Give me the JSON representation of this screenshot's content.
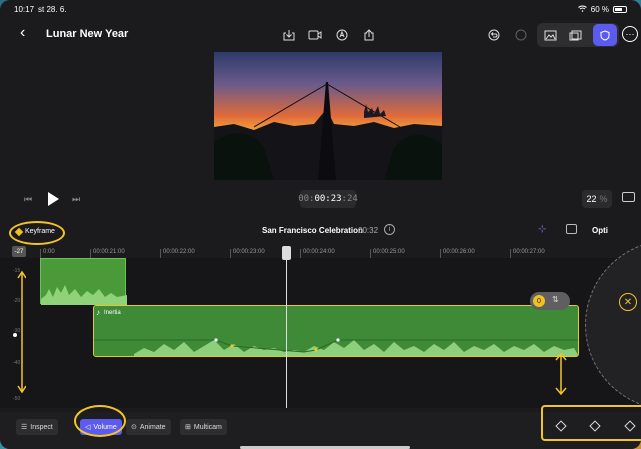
{
  "status_bar": {
    "time": "10:17",
    "date": "st 28. 6.",
    "battery": "60 %"
  },
  "nav": {
    "back_icon": "‹",
    "title": "Lunar New Year"
  },
  "transport": {
    "timecode_dim": "00:",
    "timecode": "00:23",
    "timecode_frames": ":24",
    "zoom_value": "22",
    "zoom_unit": "%"
  },
  "timeline_header": {
    "keyframe_label": "Keyframe",
    "clip_title": "San Francisco Celebration",
    "clip_duration": "00:32",
    "options_label": "Opti"
  },
  "ruler": {
    "db_top": "-27",
    "ticks": [
      "0:00",
      "00:00:21:00",
      "00:00:22:00",
      "00:00:23:00",
      "00:00:24:00",
      "00:00:25:00",
      "00:00:26:00",
      "00:00:27:00"
    ]
  },
  "meter_labels": [
    "-15",
    "-20",
    "-30",
    "-40",
    "-50"
  ],
  "audio_clip": {
    "name": "Inertia",
    "note_icon": "♪"
  },
  "volume_pill": {
    "value": "0"
  },
  "bottom_bar": {
    "inspect": "Inspect",
    "volume": "Volume",
    "animate": "Animate",
    "multicam": "Multicam"
  },
  "colors": {
    "accent": "#5b5bf0",
    "annotation": "#f3c429",
    "clip_green": "#3e8a36"
  }
}
